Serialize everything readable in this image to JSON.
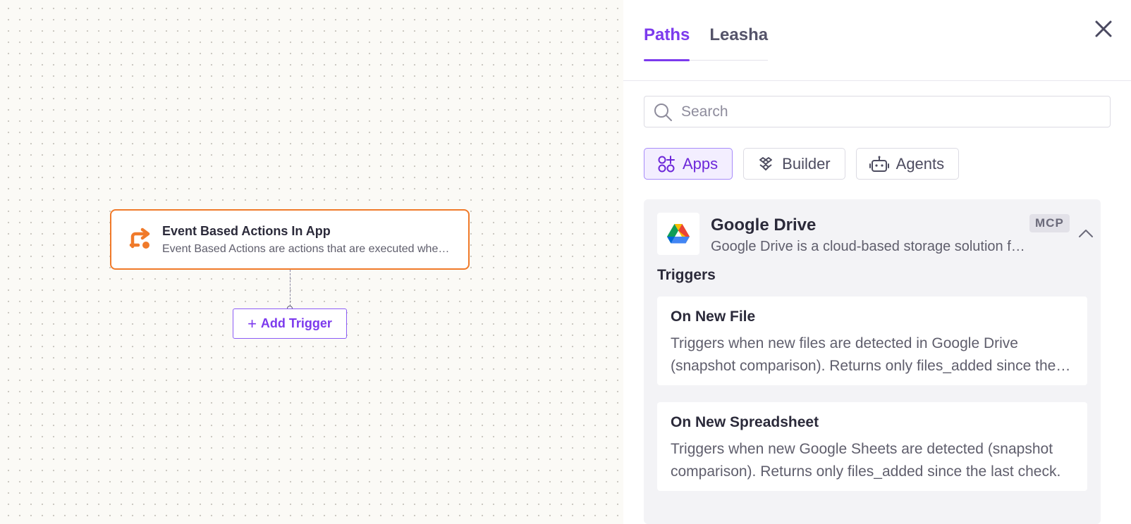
{
  "canvas": {
    "node": {
      "title": "Event Based Actions In App",
      "description": "Event Based Actions are actions that are executed when a specific event occurs in the app",
      "icon": "event-trigger-icon"
    },
    "add_trigger_label": "Add Trigger",
    "accent": "#f07a2a"
  },
  "panel": {
    "tabs": [
      {
        "label": "Paths",
        "active": true
      },
      {
        "label": "Leasha",
        "active": false
      }
    ],
    "search": {
      "placeholder": "Search",
      "value": ""
    },
    "filters": [
      {
        "label": "Apps",
        "icon": "apps-icon",
        "active": true
      },
      {
        "label": "Builder",
        "icon": "builder-icon",
        "active": false
      },
      {
        "label": "Agents",
        "icon": "robot-icon",
        "active": false
      }
    ],
    "app": {
      "name": "Google Drive",
      "description": "Google Drive is a cloud-based storage solution for storing and sharing files",
      "badge": "MCP",
      "icon": "google-drive-icon",
      "section_title": "Triggers",
      "triggers": [
        {
          "name": "On New File",
          "description": "Triggers when new files are detected in Google Drive (snapshot comparison). Returns only files_added since the last check."
        },
        {
          "name": "On New Spreadsheet",
          "description": "Triggers when new Google Sheets are detected (snapshot comparison). Returns only files_added since the last check."
        }
      ]
    },
    "accent": "#7c3aed"
  }
}
